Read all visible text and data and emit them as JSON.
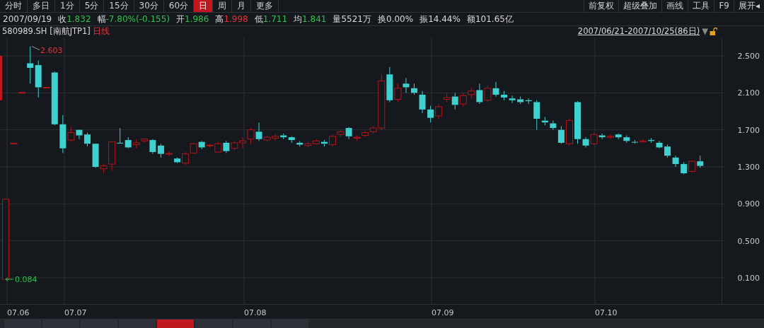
{
  "period_tabs": [
    {
      "label": "分时",
      "selected": false
    },
    {
      "label": "多日",
      "selected": false
    },
    {
      "label": "1分",
      "selected": false
    },
    {
      "label": "5分",
      "selected": false
    },
    {
      "label": "15分",
      "selected": false
    },
    {
      "label": "30分",
      "selected": false
    },
    {
      "label": "60分",
      "selected": false
    },
    {
      "label": "日",
      "selected": true
    },
    {
      "label": "周",
      "selected": false
    },
    {
      "label": "月",
      "selected": false
    },
    {
      "label": "更多",
      "selected": false
    }
  ],
  "tool_buttons": [
    "前复权",
    "超级叠加",
    "画线",
    "工具",
    "F9",
    "展开◂"
  ],
  "quote": {
    "date": "2007/09/19",
    "items": [
      {
        "label": "收",
        "value": "1.832",
        "color": "#2ec24a"
      },
      {
        "label": "幅",
        "value": "-7.80%(-0.155)",
        "color": "#2ec24a"
      },
      {
        "label": "开",
        "value": "1.986",
        "color": "#2ec24a"
      },
      {
        "label": "高",
        "value": "1.998",
        "color": "#e8333a"
      },
      {
        "label": "低",
        "value": "1.711",
        "color": "#2ec24a"
      },
      {
        "label": "均",
        "value": "1.841",
        "color": "#2ec24a"
      },
      {
        "label": "量",
        "value": "5521万",
        "color": "#d8d8d8"
      },
      {
        "label": "换",
        "value": "0.00%",
        "color": "#d8d8d8"
      },
      {
        "label": "振",
        "value": "14.44%",
        "color": "#d8d8d8"
      },
      {
        "label": "额",
        "value": "101.65亿",
        "color": "#d8d8d8"
      }
    ]
  },
  "chart": {
    "symbol": "580989.SH [南航JTP1]",
    "period": "日线",
    "range": "2007/06/21-2007/10/25(86日)",
    "range_menu": "▼",
    "locked": false,
    "high_label": "2.603",
    "low_label": "0.084",
    "x_axis_labels": [
      "07.06",
      "07.07",
      "07.08",
      "07.09",
      "07.10"
    ],
    "chart_data": {
      "type": "candlestick",
      "ylim": [
        -0.183,
        2.699
      ],
      "grid": true,
      "yticks": [
        {
          "value": 2.5,
          "label": "2.500"
        },
        {
          "value": 2.1,
          "label": "2.100"
        },
        {
          "value": 1.7,
          "label": "1.700"
        },
        {
          "value": 1.3,
          "label": "1.300"
        },
        {
          "value": 0.9,
          "label": "0.900"
        },
        {
          "value": 0.5,
          "label": "0.500"
        },
        {
          "value": 0.1,
          "label": "0.100"
        }
      ],
      "ohlc": [
        [
          0.084,
          0.95,
          0.084,
          0.95
        ],
        [
          1.55,
          1.56,
          1.55,
          1.555
        ],
        [
          2.1,
          2.11,
          2.09,
          2.105
        ],
        [
          2.42,
          2.603,
          2.2,
          2.37
        ],
        [
          2.4,
          2.45,
          2.05,
          2.16
        ],
        [
          2.16,
          2.16,
          2.16,
          2.16
        ],
        [
          2.32,
          2.33,
          1.75,
          1.76
        ],
        [
          1.76,
          1.86,
          1.45,
          1.5
        ],
        [
          1.59,
          1.73,
          1.57,
          1.67
        ],
        [
          1.7,
          1.7,
          1.6,
          1.64
        ],
        [
          1.65,
          1.67,
          1.52,
          1.55
        ],
        [
          1.55,
          1.55,
          1.29,
          1.3
        ],
        [
          1.28,
          1.33,
          1.23,
          1.31
        ],
        [
          1.33,
          1.57,
          1.26,
          1.57
        ],
        [
          1.56,
          1.72,
          1.555,
          1.555
        ],
        [
          1.59,
          1.62,
          1.5,
          1.51
        ],
        [
          1.54,
          1.6,
          1.5,
          1.56
        ],
        [
          1.58,
          1.6,
          1.56,
          1.6
        ],
        [
          1.59,
          1.6,
          1.44,
          1.46
        ],
        [
          1.53,
          1.55,
          1.4,
          1.44
        ],
        [
          1.44,
          1.47,
          1.41,
          1.445
        ],
        [
          1.39,
          1.4,
          1.34,
          1.35
        ],
        [
          1.34,
          1.46,
          1.32,
          1.44
        ],
        [
          1.45,
          1.56,
          1.44,
          1.55
        ],
        [
          1.57,
          1.58,
          1.49,
          1.51
        ],
        [
          1.53,
          1.55,
          1.51,
          1.535
        ],
        [
          1.46,
          1.57,
          1.45,
          1.55
        ],
        [
          1.56,
          1.58,
          1.45,
          1.47
        ],
        [
          1.5,
          1.58,
          1.48,
          1.56
        ],
        [
          1.56,
          1.62,
          1.5,
          1.58
        ],
        [
          1.6,
          1.72,
          1.55,
          1.7
        ],
        [
          1.68,
          1.78,
          1.58,
          1.6
        ],
        [
          1.59,
          1.64,
          1.57,
          1.62
        ],
        [
          1.61,
          1.65,
          1.58,
          1.63
        ],
        [
          1.64,
          1.66,
          1.6,
          1.62
        ],
        [
          1.62,
          1.63,
          1.56,
          1.59
        ],
        [
          1.56,
          1.58,
          1.52,
          1.54
        ],
        [
          1.53,
          1.57,
          1.51,
          1.55
        ],
        [
          1.55,
          1.6,
          1.54,
          1.58
        ],
        [
          1.57,
          1.59,
          1.52,
          1.55
        ],
        [
          1.54,
          1.65,
          1.52,
          1.63
        ],
        [
          1.65,
          1.7,
          1.62,
          1.68
        ],
        [
          1.72,
          1.73,
          1.6,
          1.63
        ],
        [
          1.61,
          1.64,
          1.58,
          1.62
        ],
        [
          1.64,
          1.69,
          1.62,
          1.67
        ],
        [
          1.68,
          1.74,
          1.66,
          1.72
        ],
        [
          1.72,
          2.3,
          1.7,
          2.23
        ],
        [
          2.3,
          2.38,
          2,
          2.02
        ],
        [
          2.03,
          2.2,
          2,
          2.15
        ],
        [
          2.2,
          2.26,
          2.1,
          2.16
        ],
        [
          2.15,
          2.2,
          2.08,
          2.1
        ],
        [
          2.08,
          2.12,
          1.88,
          1.92
        ],
        [
          1.92,
          1.96,
          1.78,
          1.83
        ],
        [
          1.85,
          1.98,
          1.82,
          1.95
        ],
        [
          2.03,
          2.1,
          2,
          2.05
        ],
        [
          2.06,
          2.1,
          1.92,
          1.97
        ],
        [
          1.98,
          2.1,
          1.95,
          2.07
        ],
        [
          2.08,
          2.15,
          2.04,
          2.12
        ],
        [
          2.13,
          2.2,
          1.98,
          2
        ],
        [
          2.02,
          2.18,
          2,
          2.15
        ],
        [
          2.15,
          2.22,
          2.06,
          2.08
        ],
        [
          2.08,
          2.12,
          2.02,
          2.05
        ],
        [
          2.04,
          2.07,
          1.99,
          2.02
        ],
        [
          2.03,
          2.06,
          1.98,
          2
        ],
        [
          2.02,
          2.04,
          1.98,
          2.01
        ],
        [
          2,
          2.02,
          1.7,
          1.82
        ],
        [
          1.8,
          1.84,
          1.75,
          1.78
        ],
        [
          1.77,
          1.8,
          1.7,
          1.72
        ],
        [
          1.7,
          1.74,
          1.55,
          1.56
        ],
        [
          1.55,
          1.82,
          1.53,
          1.8
        ],
        [
          2,
          2.01,
          1.55,
          1.6
        ],
        [
          1.6,
          1.62,
          1.51,
          1.53
        ],
        [
          1.55,
          1.67,
          1.53,
          1.65
        ],
        [
          1.64,
          1.66,
          1.6,
          1.62
        ],
        [
          1.62,
          1.65,
          1.6,
          1.63
        ],
        [
          1.65,
          1.66,
          1.6,
          1.62
        ],
        [
          1.62,
          1.64,
          1.56,
          1.58
        ],
        [
          1.57,
          1.59,
          1.55,
          1.565
        ],
        [
          1.57,
          1.6,
          1.56,
          1.58
        ],
        [
          1.59,
          1.61,
          1.56,
          1.58
        ],
        [
          1.56,
          1.58,
          1.5,
          1.51
        ],
        [
          1.52,
          1.54,
          1.4,
          1.42
        ],
        [
          1.4,
          1.42,
          1.3,
          1.33
        ],
        [
          1.33,
          1.35,
          1.22,
          1.23
        ],
        [
          1.25,
          1.37,
          1.24,
          1.36
        ],
        [
          1.36,
          1.42,
          1.29,
          1.31
        ]
      ]
    }
  },
  "bottom_tabs": [
    {
      "selected": false
    },
    {
      "selected": false
    },
    {
      "selected": false
    },
    {
      "selected": false
    },
    {
      "selected": true
    },
    {
      "selected": false
    },
    {
      "selected": false
    },
    {
      "selected": false
    }
  ]
}
